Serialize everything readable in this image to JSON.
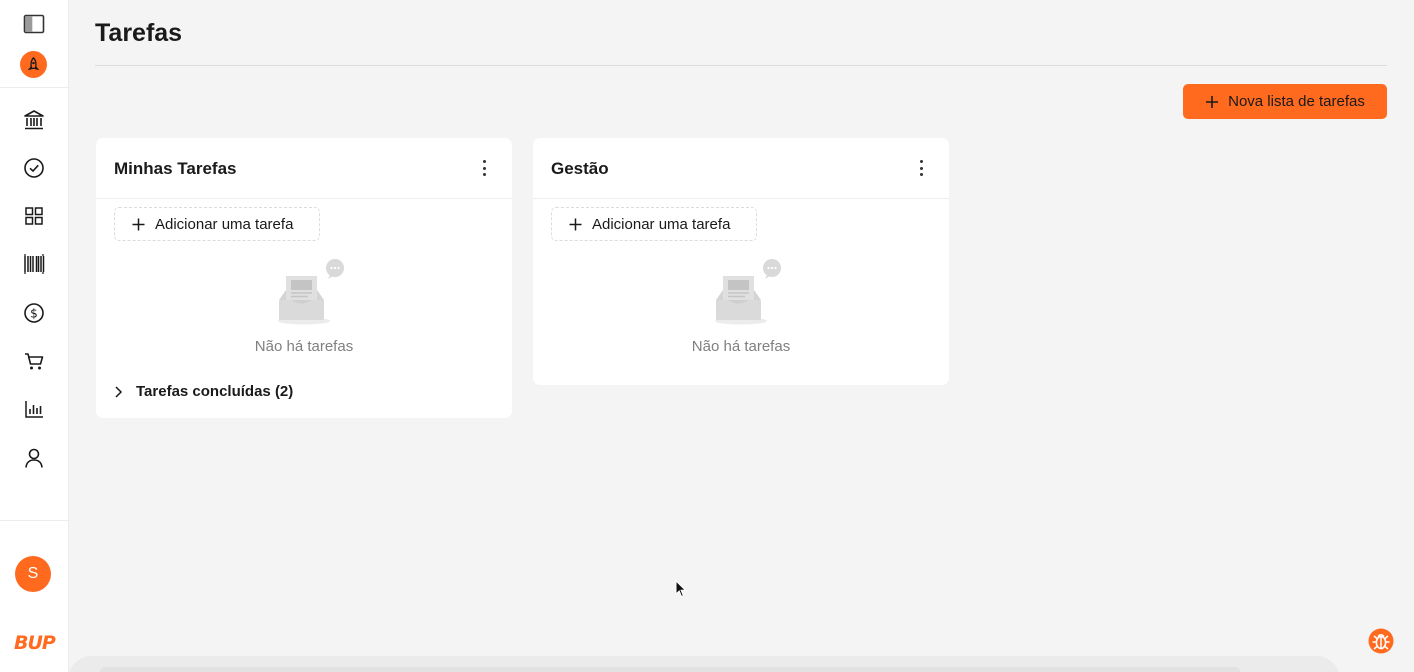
{
  "page": {
    "title": "Tarefas"
  },
  "colors": {
    "accent": "#ff6a1f",
    "background": "#f4f4f4"
  },
  "sidebar": {
    "top_icons": [
      "panel-toggle-icon",
      "rocket-icon"
    ],
    "nav_items": [
      {
        "icon": "bank-icon"
      },
      {
        "icon": "check-circle-icon"
      },
      {
        "icon": "grid-icon"
      },
      {
        "icon": "barcode-icon"
      },
      {
        "icon": "dollar-circle-icon"
      },
      {
        "icon": "cart-icon"
      },
      {
        "icon": "bar-chart-icon"
      },
      {
        "icon": "user-icon"
      }
    ],
    "avatar_initial": "S",
    "brand": "BUP"
  },
  "toolbar": {
    "new_list_label": "Nova lista de tarefas"
  },
  "lists": [
    {
      "title": "Minhas Tarefas",
      "add_task_label": "Adicionar uma tarefa",
      "empty_text": "Não há tarefas",
      "completed_label": "Tarefas concluídas (2)"
    },
    {
      "title": "Gestão",
      "add_task_label": "Adicionar uma tarefa",
      "empty_text": "Não há tarefas"
    }
  ],
  "floating": {
    "icon": "bug-icon"
  }
}
